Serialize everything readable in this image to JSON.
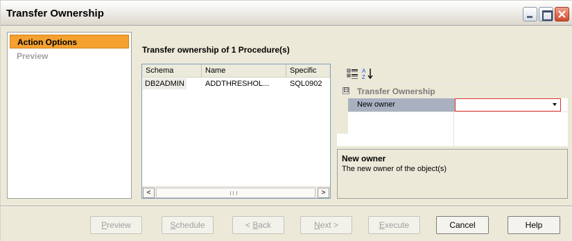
{
  "window": {
    "title": "Transfer Ownership",
    "controls": {
      "minimize": "minimize-icon",
      "maximize": "maximize-icon",
      "close": "close-icon"
    }
  },
  "nav": {
    "items": [
      {
        "label": "Action Options",
        "state": "active"
      },
      {
        "label": "Preview",
        "state": "disabled"
      }
    ]
  },
  "content": {
    "title": "Transfer ownership of 1 Procedure(s)"
  },
  "objects_list": {
    "columns": [
      "Schema",
      "Name",
      "Specific"
    ],
    "rows": [
      [
        "DB2ADMIN",
        "ADDTHRESHOL...",
        "SQL0902"
      ]
    ],
    "scroll_left_glyph": "<",
    "scroll_right_glyph": ">"
  },
  "property_grid": {
    "toolbar": {
      "categorized_icon": "categorized-icon",
      "alphabetical_icon": "sort-az-icon"
    },
    "category": {
      "toggle": "⊟",
      "label": "Transfer Ownership"
    },
    "properties": [
      {
        "name": "New owner",
        "value": ""
      }
    ],
    "description": {
      "title": "New owner",
      "text": "The new owner of the object(s)"
    }
  },
  "buttons": {
    "preview": {
      "accel": "P",
      "rest": "review",
      "enabled": false
    },
    "schedule": {
      "accel": "S",
      "rest": "chedule",
      "enabled": false
    },
    "back": {
      "pre": "< ",
      "accel": "B",
      "rest": "ack",
      "enabled": false
    },
    "next": {
      "accel": "N",
      "rest": "ext >",
      "enabled": false
    },
    "execute": {
      "accel": "E",
      "rest": "xecute",
      "enabled": false
    },
    "cancel": {
      "label": "Cancel",
      "enabled": true
    },
    "help": {
      "label": "Help",
      "enabled": true
    }
  },
  "colors": {
    "nav_active": "#f5a130",
    "required_field_border": "#e23030",
    "property_name_bg": "#a9b1c1"
  }
}
